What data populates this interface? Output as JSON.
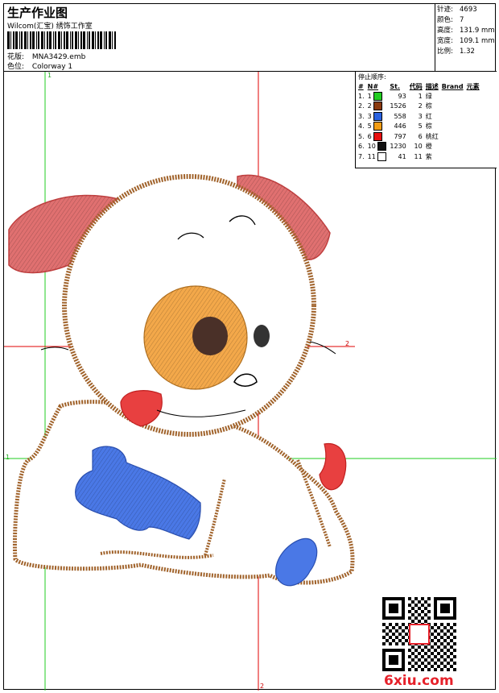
{
  "header": {
    "title": "生产作业图",
    "company": "Wilcom(汇宝) 绣饰工作室",
    "design_label": "花版:",
    "design_value": "MNA3429.emb",
    "colorway_label": "色位:",
    "colorway_value": "Colorway 1"
  },
  "stats": [
    {
      "label": "针迹:",
      "value": "4693"
    },
    {
      "label": "颜色:",
      "value": "7"
    },
    {
      "label": "高度:",
      "value": "131.9 mm"
    },
    {
      "label": "宽度:",
      "value": "109.1 mm"
    },
    {
      "label": "比例:",
      "value": "1.32"
    }
  ],
  "stop_sequence": {
    "title": "停止顺序:",
    "columns": [
      "#",
      "N#",
      "St.",
      "代码",
      "描述",
      "Brand",
      "元素"
    ],
    "rows": [
      {
        "idx": "1.",
        "n": "1",
        "color": "#22cc22",
        "st": "93",
        "code": "1",
        "desc": "绿"
      },
      {
        "idx": "2.",
        "n": "2",
        "color": "#8b3a0f",
        "st": "1526",
        "code": "2",
        "desc": "棕"
      },
      {
        "idx": "3.",
        "n": "3",
        "color": "#2a62e0",
        "st": "558",
        "code": "3",
        "desc": "红"
      },
      {
        "idx": "4.",
        "n": "5",
        "color": "#f39c12",
        "st": "446",
        "code": "5",
        "desc": "棕"
      },
      {
        "idx": "5.",
        "n": "6",
        "color": "#e81010",
        "st": "797",
        "code": "6",
        "desc": "桃红"
      },
      {
        "idx": "6.",
        "n": "10",
        "color": "#111111",
        "st": "1230",
        "code": "10",
        "desc": "橙"
      },
      {
        "idx": "7.",
        "n": "11",
        "color": "#ffffff",
        "st": "41",
        "code": "11",
        "desc": "紫"
      }
    ]
  },
  "axes": {
    "v1": "1",
    "v2": "2",
    "h1": "1",
    "h2": "2"
  },
  "watermark": {
    "text": "6xiu.com"
  },
  "colors": {
    "outline": "#a0622a",
    "ear": "#d94a4a",
    "nose": "#f0a030",
    "bone": "#3f6fe0",
    "tongue": "#e52020",
    "guide_red": "#e00000",
    "guide_green": "#22cc22"
  }
}
